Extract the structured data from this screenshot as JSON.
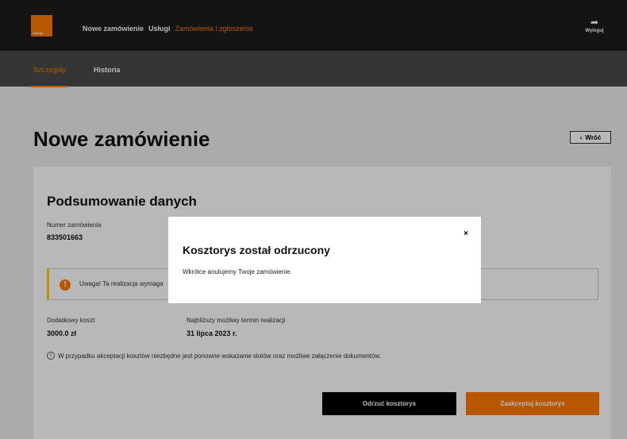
{
  "header": {
    "logo_text": "orange",
    "nav": [
      {
        "label": "Nowe zamówienie"
      },
      {
        "label": "Usługi"
      },
      {
        "label": "Zamówienia i zgłoszenia"
      }
    ],
    "logout_label": "Wyloguj"
  },
  "subnav": {
    "tabs": [
      {
        "label": "Szczegóły"
      },
      {
        "label": "Historia"
      }
    ]
  },
  "page": {
    "title": "Nowe zamówienie",
    "back_label": "Wróć"
  },
  "summary": {
    "section_title": "Podsumowanie danych",
    "order_number_label": "Numer zamówienia",
    "order_number": "833501663",
    "warning_text": "Uwaga! Ta realizacja wymaga",
    "extra_cost_label": "Dodatkowy koszt",
    "extra_cost_value": "3000.0 zł",
    "earliest_label": "Najbliższy możliwy termin realizacji",
    "earliest_value": "31 lipca 2023 r.",
    "info_text": "W przypadku akceptacji kosztów niezbędne jest ponowne wskazanie slotów oraz możliwe załączenie dokumentów.",
    "reject_label": "Odrzuć kosztorys",
    "accept_label": "Zaakceptuj kosztorys"
  },
  "modal": {
    "title": "Kosztorys został odrzucony",
    "text": "Wkrótce anulujemy Twoje zamówienie.",
    "close_symbol": "×"
  },
  "colors": {
    "accent": "#ff7900",
    "header_bg": "#1c1c1c",
    "subnav_bg": "#4a4a4a",
    "warning_border": "#ffcc00"
  }
}
